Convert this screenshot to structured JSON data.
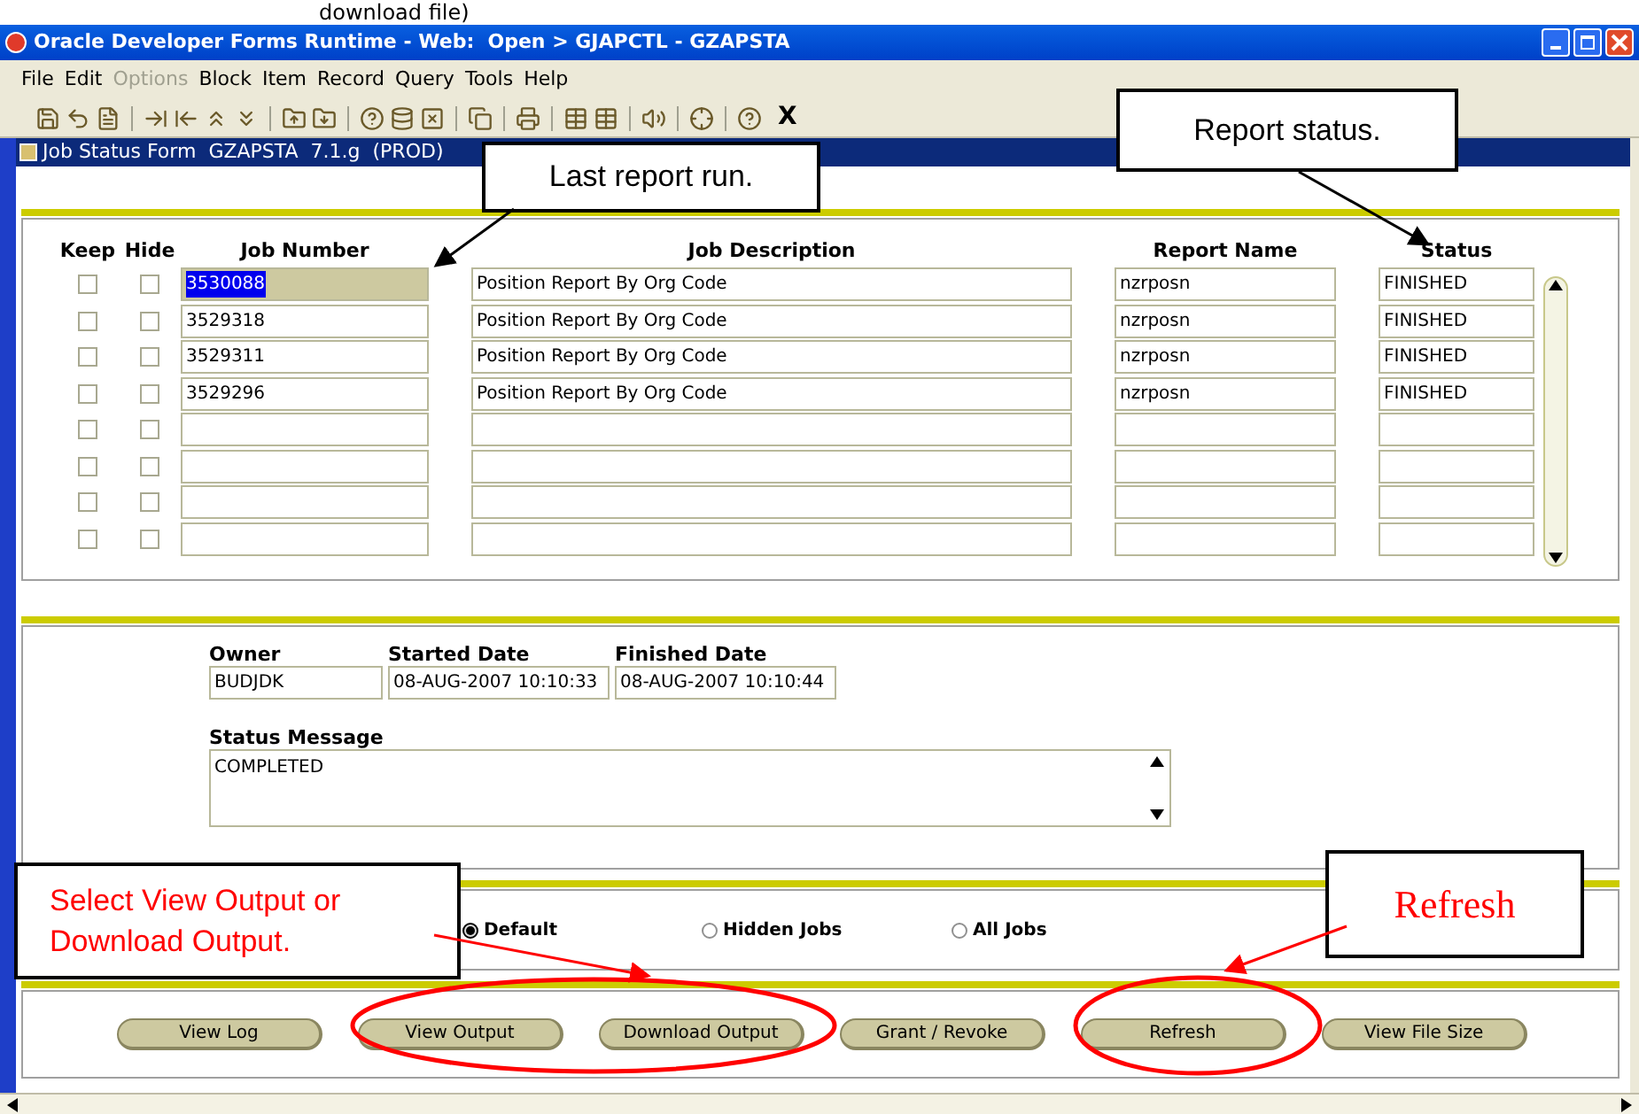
{
  "caption": "download file)",
  "window": {
    "title": "Oracle Developer Forms Runtime - Web:  Open > GJAPCTL - GZAPSTA"
  },
  "menu": [
    {
      "label": "File",
      "disabled": false
    },
    {
      "label": "Edit",
      "disabled": false
    },
    {
      "label": "Options",
      "disabled": true
    },
    {
      "label": "Block",
      "disabled": false
    },
    {
      "label": "Item",
      "disabled": false
    },
    {
      "label": "Record",
      "disabled": false
    },
    {
      "label": "Query",
      "disabled": false
    },
    {
      "label": "Tools",
      "disabled": false
    },
    {
      "label": "Help",
      "disabled": false
    }
  ],
  "toolbar": {
    "exit_label": "X"
  },
  "form": {
    "title": "Job Status Form  GZAPSTA  7.1.g  (PROD)"
  },
  "jobs": {
    "columns": [
      "Keep",
      "Hide",
      "Job Number",
      "Job Description",
      "Report Name",
      "Status"
    ],
    "rows": [
      {
        "keep": false,
        "hide": false,
        "selected": true,
        "job_number": "3530088",
        "description": "Position Report By Org Code",
        "report_name": "nzrposn",
        "status": "FINISHED"
      },
      {
        "keep": false,
        "hide": false,
        "selected": false,
        "job_number": "3529318",
        "description": "Position Report By Org Code",
        "report_name": "nzrposn",
        "status": "FINISHED"
      },
      {
        "keep": false,
        "hide": false,
        "selected": false,
        "job_number": "3529311",
        "description": "Position Report By Org Code",
        "report_name": "nzrposn",
        "status": "FINISHED"
      },
      {
        "keep": false,
        "hide": false,
        "selected": false,
        "job_number": "3529296",
        "description": "Position Report By Org Code",
        "report_name": "nzrposn",
        "status": "FINISHED"
      },
      {
        "keep": false,
        "hide": false,
        "selected": false
      },
      {
        "keep": false,
        "hide": false,
        "selected": false
      },
      {
        "keep": false,
        "hide": false,
        "selected": false
      },
      {
        "keep": false,
        "hide": false,
        "selected": false
      }
    ]
  },
  "details": {
    "owner": {
      "label": "Owner",
      "value": "BUDJDK"
    },
    "started": {
      "label": "Started Date",
      "value": "08-AUG-2007 10:10:33"
    },
    "finished": {
      "label": "Finished Date",
      "value": "08-AUG-2007 10:10:44"
    },
    "status_message": {
      "label": "Status Message",
      "value": "COMPLETED"
    }
  },
  "radios": [
    {
      "label": "Default",
      "selected": true
    },
    {
      "label": "Hidden Jobs",
      "selected": false
    },
    {
      "label": "All Jobs",
      "selected": false
    }
  ],
  "buttons": [
    "View Log",
    "View Output",
    "Download Output",
    "Grant / Revoke",
    "Refresh",
    "View File Size"
  ],
  "annotations": [
    {
      "kind": "callout",
      "text": "Last report run."
    },
    {
      "kind": "callout",
      "text": "Report status."
    },
    {
      "kind": "red_callout",
      "text": "Select View Output or Download Output."
    },
    {
      "kind": "red_serif",
      "text": "Refresh"
    }
  ]
}
